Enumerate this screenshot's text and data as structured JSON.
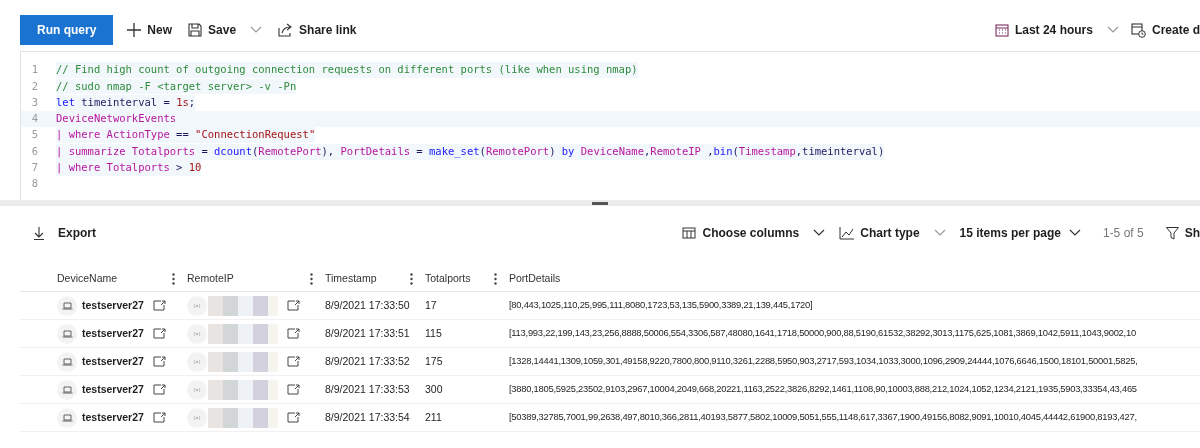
{
  "toolbar": {
    "run": "Run query",
    "actions": [
      {
        "kind": "new",
        "label": "New",
        "dropdown": false
      },
      {
        "kind": "save",
        "label": "Save",
        "dropdown": true
      },
      {
        "kind": "share",
        "label": "Share link",
        "dropdown": false
      }
    ],
    "right": [
      {
        "kind": "calendar",
        "label": "Last 24 hours",
        "dropdown": true
      },
      {
        "kind": "create",
        "label": "Create d",
        "dropdown": false
      }
    ]
  },
  "editor": {
    "lines": [
      {
        "number": "1",
        "current": false,
        "tokens": [
          {
            "kind": "comment",
            "text": "// Find high count of outgoing connection requests on different ports (like when using nmap)"
          }
        ]
      },
      {
        "number": "2",
        "current": false,
        "tokens": [
          {
            "kind": "comment",
            "text": "// sudo nmap -F <target server> -v -Pn"
          }
        ]
      },
      {
        "number": "3",
        "current": false,
        "tokens": [
          {
            "kind": "keyword",
            "text": "let"
          },
          {
            "kind": "plain",
            "text": " timeinterval = "
          },
          {
            "kind": "number",
            "text": "1s"
          },
          {
            "kind": "plain",
            "text": ";"
          }
        ]
      },
      {
        "number": "4",
        "current": true,
        "tokens": [
          {
            "kind": "table",
            "text": "DeviceNetworkEvents"
          }
        ]
      },
      {
        "number": "5",
        "current": false,
        "tokens": [
          {
            "kind": "operator",
            "text": "| where "
          },
          {
            "kind": "column",
            "text": "ActionType"
          },
          {
            "kind": "plain",
            "text": " == "
          },
          {
            "kind": "string",
            "text": "\"ConnectionRequest\""
          }
        ]
      },
      {
        "number": "6",
        "current": false,
        "tokens": [
          {
            "kind": "operator",
            "text": "| summarize "
          },
          {
            "kind": "column",
            "text": "Totalports"
          },
          {
            "kind": "plain",
            "text": " = "
          },
          {
            "kind": "function",
            "text": "dcount"
          },
          {
            "kind": "plain",
            "text": "("
          },
          {
            "kind": "column",
            "text": "RemotePort"
          },
          {
            "kind": "plain",
            "text": "), "
          },
          {
            "kind": "column",
            "text": "PortDetails"
          },
          {
            "kind": "plain",
            "text": " = "
          },
          {
            "kind": "function",
            "text": "make_set"
          },
          {
            "kind": "plain",
            "text": "("
          },
          {
            "kind": "column",
            "text": "RemotePort"
          },
          {
            "kind": "plain",
            "text": ") "
          },
          {
            "kind": "keyword",
            "text": "by "
          },
          {
            "kind": "column",
            "text": "DeviceName"
          },
          {
            "kind": "plain",
            "text": ","
          },
          {
            "kind": "column",
            "text": "RemoteIP"
          },
          {
            "kind": "plain",
            "text": " ,"
          },
          {
            "kind": "function",
            "text": "bin"
          },
          {
            "kind": "plain",
            "text": "("
          },
          {
            "kind": "column",
            "text": "Timestamp"
          },
          {
            "kind": "plain",
            "text": ",timeinterval)"
          }
        ]
      },
      {
        "number": "7",
        "current": false,
        "tokens": [
          {
            "kind": "operator",
            "text": "| where "
          },
          {
            "kind": "column",
            "text": "Totalports"
          },
          {
            "kind": "plain",
            "text": " > "
          },
          {
            "kind": "number",
            "text": "10"
          }
        ]
      },
      {
        "number": "8",
        "current": false
      }
    ]
  },
  "results_toolbar": {
    "export": "Export",
    "choose_columns": "Choose columns",
    "chart_type": "Chart type",
    "per_page": "15 items per page",
    "range": "1-5 of 5",
    "filter": "Sh"
  },
  "table": {
    "columns": [
      "DeviceName",
      "RemoteIP",
      "Timestamp",
      "Totalports",
      "PortDetails"
    ],
    "rows": [
      {
        "device": "testserver27",
        "timestamp": "8/9/2021 17:33:50",
        "totalports": "17",
        "ports": "[80,443,1025,110,25,995,111,8080,1723,53,135,5900,3389,21,139,445,1720]"
      },
      {
        "device": "testserver27",
        "timestamp": "8/9/2021 17:33:51",
        "totalports": "115",
        "ports": "[113,993,22,199,143,23,256,8888,50006,554,3306,587,48080,1641,1718,50000,900,88,5190,61532,38292,3013,1175,625,1081,3869,1042,5911,1043,9002,10"
      },
      {
        "device": "testserver27",
        "timestamp": "8/9/2021 17:33:52",
        "totalports": "175",
        "ports": "[1328,14441,1309,1059,301,49158,9220,7800,800,9110,3261,2288,5950,903,2717,593,1034,1033,3000,1096,2909,24444,1076,6646,1500,18101,50001,5825,"
      },
      {
        "device": "testserver27",
        "timestamp": "8/9/2021 17:33:53",
        "totalports": "300",
        "ports": "[3880,1805,5925,23502,9103,2967,10004,2049,668,20221,1163,2522,3826,8292,1461,1108,90,10003,888,212,1024,1052,1234,2121,1935,5903,33354,43,465"
      },
      {
        "device": "testserver27",
        "timestamp": "8/9/2021 17:33:54",
        "totalports": "211",
        "ports": "[50389,32785,7001,99,2638,497,8010,366,2811,40193,5877,5802,10009,5051,555,1148,617,3367,1900,49156,8082,9091,10010,4045,44442,61900,8193,427,"
      }
    ]
  }
}
